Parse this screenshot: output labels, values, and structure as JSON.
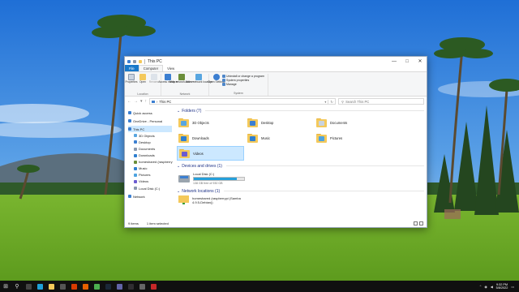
{
  "window": {
    "title": "This PC",
    "controls": {
      "minimize": "—",
      "maximize": "□",
      "close": "✕"
    }
  },
  "menu": {
    "file": "File",
    "tabs": [
      "Computer",
      "View"
    ]
  },
  "ribbon": {
    "location": {
      "label": "Location",
      "buttons": [
        "Properties",
        "Open",
        "Rename"
      ]
    },
    "network": {
      "label": "Network",
      "buttons": [
        "Access media ▾",
        "Map network drive ▾",
        "Add a network location"
      ]
    },
    "system": {
      "label": "System",
      "open_settings": "Open Settings",
      "items": [
        "Uninstall or change a program",
        "System properties",
        "Manage"
      ]
    }
  },
  "address": {
    "back": "←",
    "forward": "→",
    "recent": "▾",
    "up": "↑",
    "path_prefix": "›",
    "path": "This PC",
    "dropdown": "▾",
    "refresh": "↻",
    "search_placeholder": "Search This PC"
  },
  "nav": {
    "items": [
      {
        "label": "Quick access",
        "icon": "star-icon",
        "color": "#3c7fd1",
        "sub": false
      },
      {
        "label": "OneDrive - Personal",
        "icon": "cloud-icon",
        "color": "#3c7fd1",
        "sub": false
      },
      {
        "label": "This PC",
        "icon": "computer-icon",
        "color": "#3c7fd1",
        "sub": false,
        "selected": true
      },
      {
        "label": "3D Objects",
        "icon": "cube-icon",
        "color": "#58a6e0",
        "sub": true
      },
      {
        "label": "Desktop",
        "icon": "desktop-icon",
        "color": "#3c7fd1",
        "sub": true
      },
      {
        "label": "Documents",
        "icon": "document-icon",
        "color": "#8a98ad",
        "sub": true
      },
      {
        "label": "Downloads",
        "icon": "download-icon",
        "color": "#2f7fd0",
        "sub": true
      },
      {
        "label": "homeshared (raspberry",
        "icon": "network-drive-icon",
        "color": "#6b8e3a",
        "sub": true
      },
      {
        "label": "Music",
        "icon": "music-icon",
        "color": "#2f7fd0",
        "sub": true
      },
      {
        "label": "Pictures",
        "icon": "picture-icon",
        "color": "#4da3e0",
        "sub": true
      },
      {
        "label": "Videos",
        "icon": "video-icon",
        "color": "#6b5bd1",
        "sub": true
      },
      {
        "label": "Local Disk (C:)",
        "icon": "drive-icon",
        "color": "#8a98ad",
        "sub": true
      },
      {
        "label": "Network",
        "icon": "network-icon",
        "color": "#3c7fd1",
        "sub": false
      }
    ]
  },
  "sections": {
    "folders": "Folders (7)",
    "drives": "Devices and drives (1)",
    "network": "Network locations (1)"
  },
  "folders": [
    {
      "label": "3D Objects",
      "mark": "#58a6e0",
      "icon": "3d-objects-folder-icon"
    },
    {
      "label": "Desktop",
      "mark": "#3c7fd1",
      "icon": "desktop-folder-icon"
    },
    {
      "label": "Documents",
      "mark": "#c9d3df",
      "icon": "documents-folder-icon"
    },
    {
      "label": "Downloads",
      "mark": "#2f7fd0",
      "icon": "downloads-folder-icon"
    },
    {
      "label": "Music",
      "mark": "#2f7fd0",
      "icon": "music-folder-icon"
    },
    {
      "label": "Pictures",
      "mark": "#4da3e0",
      "icon": "pictures-folder-icon"
    },
    {
      "label": "Videos",
      "mark": "#6b5bd1",
      "icon": "videos-folder-icon",
      "selected": true
    }
  ],
  "drive": {
    "name": "Local Disk (C:)",
    "free_text": "138 GB free of 930 GB",
    "used_fraction": 0.85
  },
  "network_location": {
    "line1": "homeshared (raspberrypi (Samba",
    "line2": "4.9.5-Debian))"
  },
  "status": {
    "items": "9 items",
    "selected": "1 item selected"
  },
  "taskbar": {
    "start": "⊞",
    "search": "⚲",
    "apps": [
      {
        "icon": "task-view-icon",
        "color": "#444"
      },
      {
        "icon": "edge-icon",
        "color": "#1fa0d8"
      },
      {
        "icon": "file-explorer-icon",
        "color": "#f4c95b"
      },
      {
        "icon": "store-icon",
        "color": "#555"
      },
      {
        "icon": "office-icon",
        "color": "#d83b01"
      },
      {
        "icon": "firefox-icon",
        "color": "#e66000"
      },
      {
        "icon": "chrome-icon",
        "color": "#4caf50"
      },
      {
        "icon": "steam-icon",
        "color": "#1b2838"
      },
      {
        "icon": "teams-icon",
        "color": "#6264a7"
      },
      {
        "icon": "obs-icon",
        "color": "#302e31"
      },
      {
        "icon": "settings-icon",
        "color": "#666"
      },
      {
        "icon": "recorder-icon",
        "color": "#c62828"
      }
    ],
    "time": "9:32 PM",
    "date": "5/8/2022"
  }
}
